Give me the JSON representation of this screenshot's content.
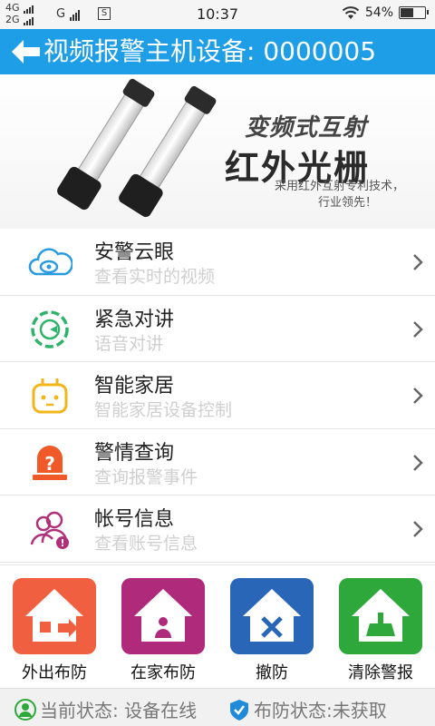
{
  "status_bar": {
    "net1": "4G",
    "net2": "2G",
    "net3": "G",
    "s_box": "S",
    "time": "10:37",
    "battery": "54%",
    "battery_level": 0.54
  },
  "header": {
    "title": "视频报警主机设备: 0000005",
    "back_icon": "arrow-left-icon"
  },
  "banner": {
    "headline": "变频式互射",
    "product": "红外光栅",
    "tagline1": "采用红外互射专利技术，",
    "tagline2": "行业领先！"
  },
  "menu": [
    {
      "title": "安警云眼",
      "subtitle": "查看实时的视频",
      "icon": "cloud-camera-icon"
    },
    {
      "title": "紧急对讲",
      "subtitle": "语音对讲",
      "icon": "intercom-icon"
    },
    {
      "title": "智能家居",
      "subtitle": "智能家居设备控制",
      "icon": "smart-plug-icon"
    },
    {
      "title": "警情查询",
      "subtitle": "查询报警事件",
      "icon": "alarm-light-icon"
    },
    {
      "title": "帐号信息",
      "subtitle": "查看账号信息",
      "icon": "account-icon"
    }
  ],
  "actions": [
    {
      "label": "外出布防",
      "color": "#f06040",
      "icon": "away-arm-icon"
    },
    {
      "label": "在家布防",
      "color": "#b02a7c",
      "icon": "home-arm-icon"
    },
    {
      "label": "撤防",
      "color": "#2a66b8",
      "icon": "disarm-icon"
    },
    {
      "label": "清除警报",
      "color": "#2ea83a",
      "icon": "clear-alarm-icon"
    }
  ],
  "footer": {
    "current_status": "当前状态: 设备在线",
    "arm_status": "布防状态:未获取"
  },
  "colors": {
    "header_bg": "#1e9ee6",
    "accent_green": "#2ea83a"
  }
}
